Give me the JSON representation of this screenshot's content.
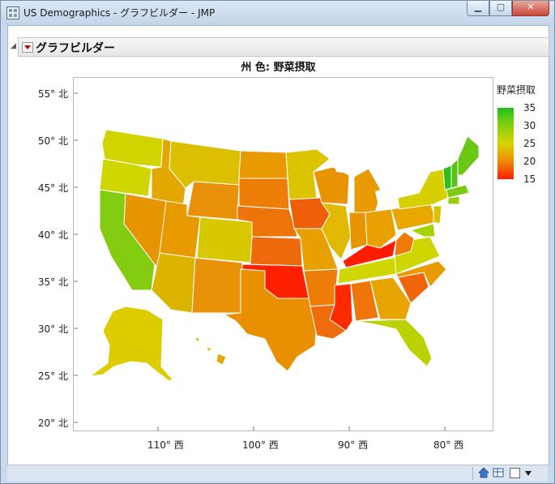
{
  "window": {
    "title": "US Demographics - グラフビルダー - JMP"
  },
  "report": {
    "outline_title": "グラフビルダー"
  },
  "chart": {
    "title": "州 色: 野菜摂取"
  },
  "legend": {
    "title": "野菜摂取",
    "values": [
      "35",
      "30",
      "25",
      "20",
      "15"
    ],
    "colors": [
      "#1cc21c",
      "#d8d400",
      "#ff1a00"
    ]
  },
  "chart_data": {
    "type": "map",
    "title": "州 色: 野菜摂取",
    "color_variable": "野菜摂取",
    "color_range": [
      15,
      35
    ],
    "y_ticks": [
      "55° 北",
      "50° 北",
      "45° 北",
      "40° 北",
      "35° 北",
      "30° 北",
      "25° 北",
      "20° 北"
    ],
    "x_ticks": [
      "110° 西",
      "100° 西",
      "90° 西",
      "80° 西"
    ],
    "grid": false,
    "legend_position": "right"
  }
}
